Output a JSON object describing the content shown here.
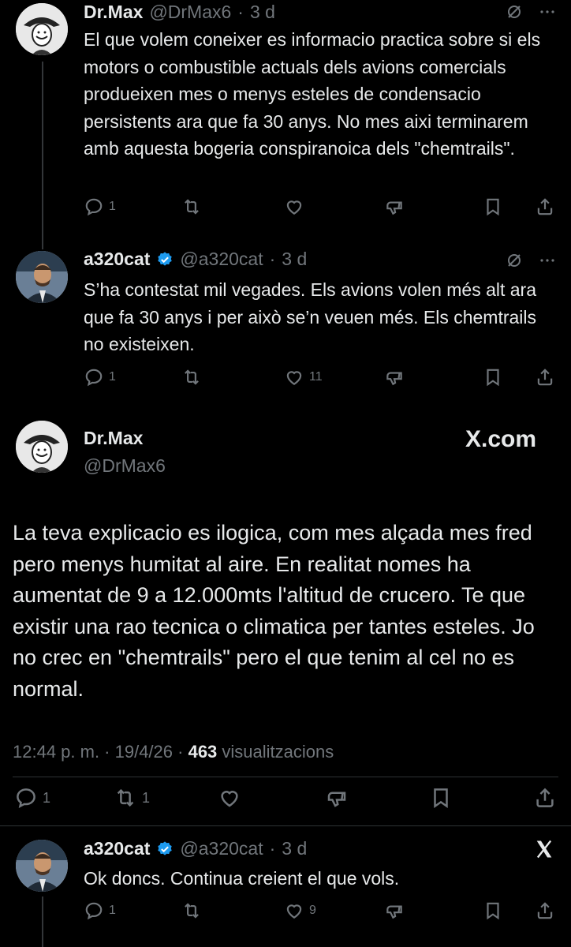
{
  "tweets": [
    {
      "name": "Dr.Max",
      "handle": "@DrMax6",
      "time": "3 d",
      "text": "El que volem coneixer es informacio practica sobre si els motors o combustible actuals dels avions comercials produeixen mes o menys esteles de condensacio persistents ara que fa 30 anys. No mes aixi terminarem amb aquesta bogeria conspiranoica dels \"chemtrails\".",
      "replies": "1",
      "reposts": "",
      "likes": ""
    },
    {
      "name": "a320cat",
      "handle": "@a320cat",
      "time": "3 d",
      "text": "S’ha contestat mil vegades. Els avions volen més alt ara que fa 30 anys i per això se’n veuen més. Els chemtrails no existeixen.",
      "replies": "1",
      "reposts": "",
      "likes": "11"
    }
  ],
  "main": {
    "name": "Dr.Max",
    "handle": "@DrMax6",
    "brand": "X.com",
    "text": "La teva explicacio es ilogica, com mes alçada mes fred pero menys humitat al aire. En realitat nomes ha aumentat de 9 a 12.000mts l'altitud de crucero. Te que existir una rao tecnica o climatica per tantes esteles. Jo no crec en \"chemtrails\" pero el que tenim al cel no es normal.",
    "time": "12:44 p. m. · 19/4/26 · ",
    "views_count": "463",
    "views_label": " visualitzacions",
    "replies": "1",
    "reposts": "1"
  },
  "reply": {
    "name": "a320cat",
    "handle": "@a320cat",
    "time": "3 d",
    "text": "Ok doncs. Continua creient el que vols.",
    "replies": "1",
    "likes": "9"
  },
  "colors": {
    "background": "#000000",
    "text": "#e7e9ea",
    "muted": "#71767b",
    "verified": "#1d9bf0"
  },
  "icons": [
    "grok-icon",
    "more-icon",
    "reply-icon",
    "repost-icon",
    "like-icon",
    "views-icon",
    "bookmark-icon",
    "share-icon",
    "verified-icon",
    "x-logo-icon"
  ]
}
